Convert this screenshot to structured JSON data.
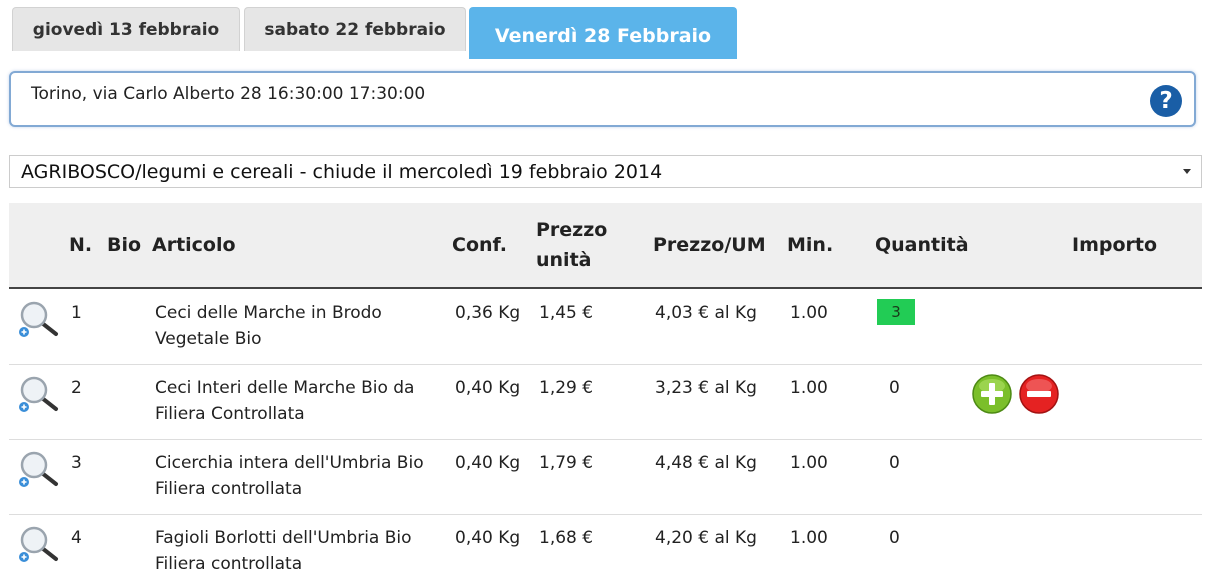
{
  "tabs": [
    {
      "label": "giovedì 13 febbraio"
    },
    {
      "label": "sabato 22 febbraio"
    },
    {
      "label": "Venerdì 28 Febbraio"
    }
  ],
  "location": {
    "text": "Torino, via Carlo Alberto 28 16:30:00 17:30:00"
  },
  "help": {
    "label": "?"
  },
  "supplier_select": {
    "value": "AGRIBOSCO/legumi e cereali - chiude il mercoledì 19 febbraio 2014"
  },
  "table": {
    "headers": {
      "n": "N.",
      "bio": "Bio",
      "articolo": "Articolo",
      "conf": "Conf.",
      "prezzo_unita_1": "Prezzo",
      "prezzo_unita_2": "unità",
      "prezzo_um": "Prezzo/UM",
      "min": "Min.",
      "quantita": "Quantità",
      "importo": "Importo"
    },
    "rows": [
      {
        "n": "1",
        "articolo_1": "Ceci delle Marche in Brodo",
        "articolo_2": "Vegetale Bio",
        "conf": "0,36 Kg",
        "prezzo": "1,45 €",
        "prezzo_um": "4,03 € al Kg",
        "min": "1.00",
        "quantita": "3"
      },
      {
        "n": "2",
        "articolo_1": "Ceci Interi delle Marche Bio da",
        "articolo_2": "Filiera Controllata",
        "conf": "0,40 Kg",
        "prezzo": "1,29 €",
        "prezzo_um": "3,23 € al Kg",
        "min": "1.00",
        "quantita": "0"
      },
      {
        "n": "3",
        "articolo_1": "Cicerchia intera dell'Umbria Bio",
        "articolo_2": "Filiera controllata",
        "conf": "0,40 Kg",
        "prezzo": "1,79 €",
        "prezzo_um": "4,48 € al Kg",
        "min": "1.00",
        "quantita": "0"
      },
      {
        "n": "4",
        "articolo_1": "Fagioli Borlotti dell'Umbria Bio",
        "articolo_2": "Filiera controllata",
        "conf": "0,40 Kg",
        "prezzo": "1,68 €",
        "prezzo_um": "4,20 € al Kg",
        "min": "1.00",
        "quantita": "0"
      }
    ]
  },
  "colors": {
    "active_tab": "#5bb4ea",
    "qty_highlight": "#22cc55",
    "plus_button": "#7bbf2a",
    "minus_button": "#e52222",
    "help_icon": "#1a5ea6"
  },
  "icons": {
    "zoom": "magnifier-plus-icon",
    "plus": "add-circle-icon",
    "minus": "remove-circle-icon",
    "help": "question-circle-icon",
    "select_arrow": "chevron-down-icon"
  }
}
